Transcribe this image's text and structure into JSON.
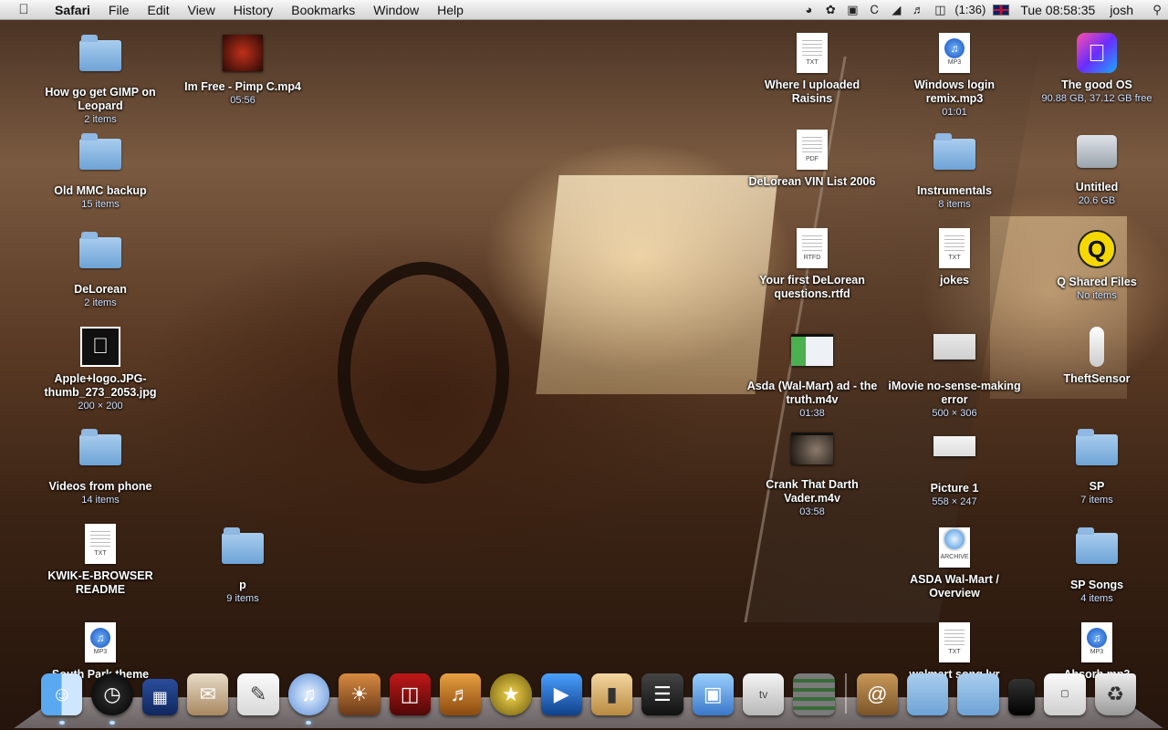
{
  "menubar": {
    "apple_icon": "apple-logo",
    "app_name": "Safari",
    "menus": [
      "File",
      "Edit",
      "View",
      "History",
      "Bookmarks",
      "Window",
      "Help"
    ],
    "battery": "(1:36)",
    "clock": "Tue 08:58:35",
    "user": "josh"
  },
  "desktop": {
    "items": [
      {
        "name": "How go get GIMP on Leopard",
        "sub": "2 items",
        "kind": "folder"
      },
      {
        "name": "Im Free - Pimp C.mp4",
        "sub": "05:56",
        "kind": "video"
      },
      {
        "name": "Where I uploaded Raisins",
        "sub": "",
        "kind": "txt",
        "tag": "TXT"
      },
      {
        "name": "Windows login remix.mp3",
        "sub": "01:01",
        "kind": "mp3",
        "tag": "MP3"
      },
      {
        "name": "The good OS",
        "sub": "90.88 GB, 37.12 GB free",
        "kind": "disk-os"
      },
      {
        "name": "Old MMC backup",
        "sub": "15 items",
        "kind": "folder"
      },
      {
        "name": "DeLorean VIN List 2006",
        "sub": "",
        "kind": "pdf",
        "tag": "PDF"
      },
      {
        "name": "Instrumentals",
        "sub": "8 items",
        "kind": "folder"
      },
      {
        "name": "Untitled",
        "sub": "20.6 GB",
        "kind": "drive"
      },
      {
        "name": "DeLorean",
        "sub": "2 items",
        "kind": "folder"
      },
      {
        "name": "Your first DeLorean questions.rtfd",
        "sub": "",
        "kind": "rtfd",
        "tag": "RTFD"
      },
      {
        "name": "jokes",
        "sub": "",
        "kind": "txt",
        "tag": "TXT"
      },
      {
        "name": "Q Shared Files",
        "sub": "No items",
        "kind": "q"
      },
      {
        "name": "Apple+logo.JPG-thumb_273_2053.jpg",
        "sub": "200 × 200",
        "kind": "apple-image"
      },
      {
        "name": "Asda (Wal-Mart) ad - the truth.m4v",
        "sub": "01:38",
        "kind": "video2"
      },
      {
        "name": "iMovie no-sense-making error",
        "sub": "500 × 306",
        "kind": "screenshot"
      },
      {
        "name": "TheftSensor",
        "sub": "",
        "kind": "remote"
      },
      {
        "name": "Videos from phone",
        "sub": "14 items",
        "kind": "folder"
      },
      {
        "name": "Crank That Darth Vader.m4v",
        "sub": "03:58",
        "kind": "video3"
      },
      {
        "name": "Picture 1",
        "sub": "558 × 247",
        "kind": "screenshot"
      },
      {
        "name": "SP",
        "sub": "7 items",
        "kind": "folder"
      },
      {
        "name": "KWIK-E-BROWSER README",
        "sub": "",
        "kind": "txt",
        "tag": "TXT"
      },
      {
        "name": "p",
        "sub": "9 items",
        "kind": "folder"
      },
      {
        "name": "ASDA Wal-Mart / Overview",
        "sub": "",
        "kind": "archive",
        "tag": "ARCHIVE"
      },
      {
        "name": "SP Songs",
        "sub": "4 items",
        "kind": "folder"
      },
      {
        "name": "South Park theme",
        "sub": "",
        "kind": "mp3",
        "tag": "MP3"
      },
      {
        "name": "walmart song lyr",
        "sub": "",
        "kind": "txt",
        "tag": "TXT"
      },
      {
        "name": "Absorb.mp3",
        "sub": "",
        "kind": "mp3",
        "tag": "MP3"
      }
    ]
  },
  "dock": {
    "items": [
      "Finder",
      "Dashboard",
      "TARDIS",
      "Mail & Photos",
      "TextEdit",
      "iTunes",
      "iPhoto",
      "Front Row",
      "GarageBand",
      "iMovie",
      "Final Cut",
      "Switch",
      "Clapper",
      "Preview",
      "Apple TV",
      "Network",
      "Address Book",
      "Folder",
      "Folder",
      "iPhone",
      "Image",
      "Trash"
    ]
  },
  "colors": {
    "menubar": "#e3e3e3",
    "folder": "#8fb8e2",
    "label_sub": "#cfe0ff"
  }
}
